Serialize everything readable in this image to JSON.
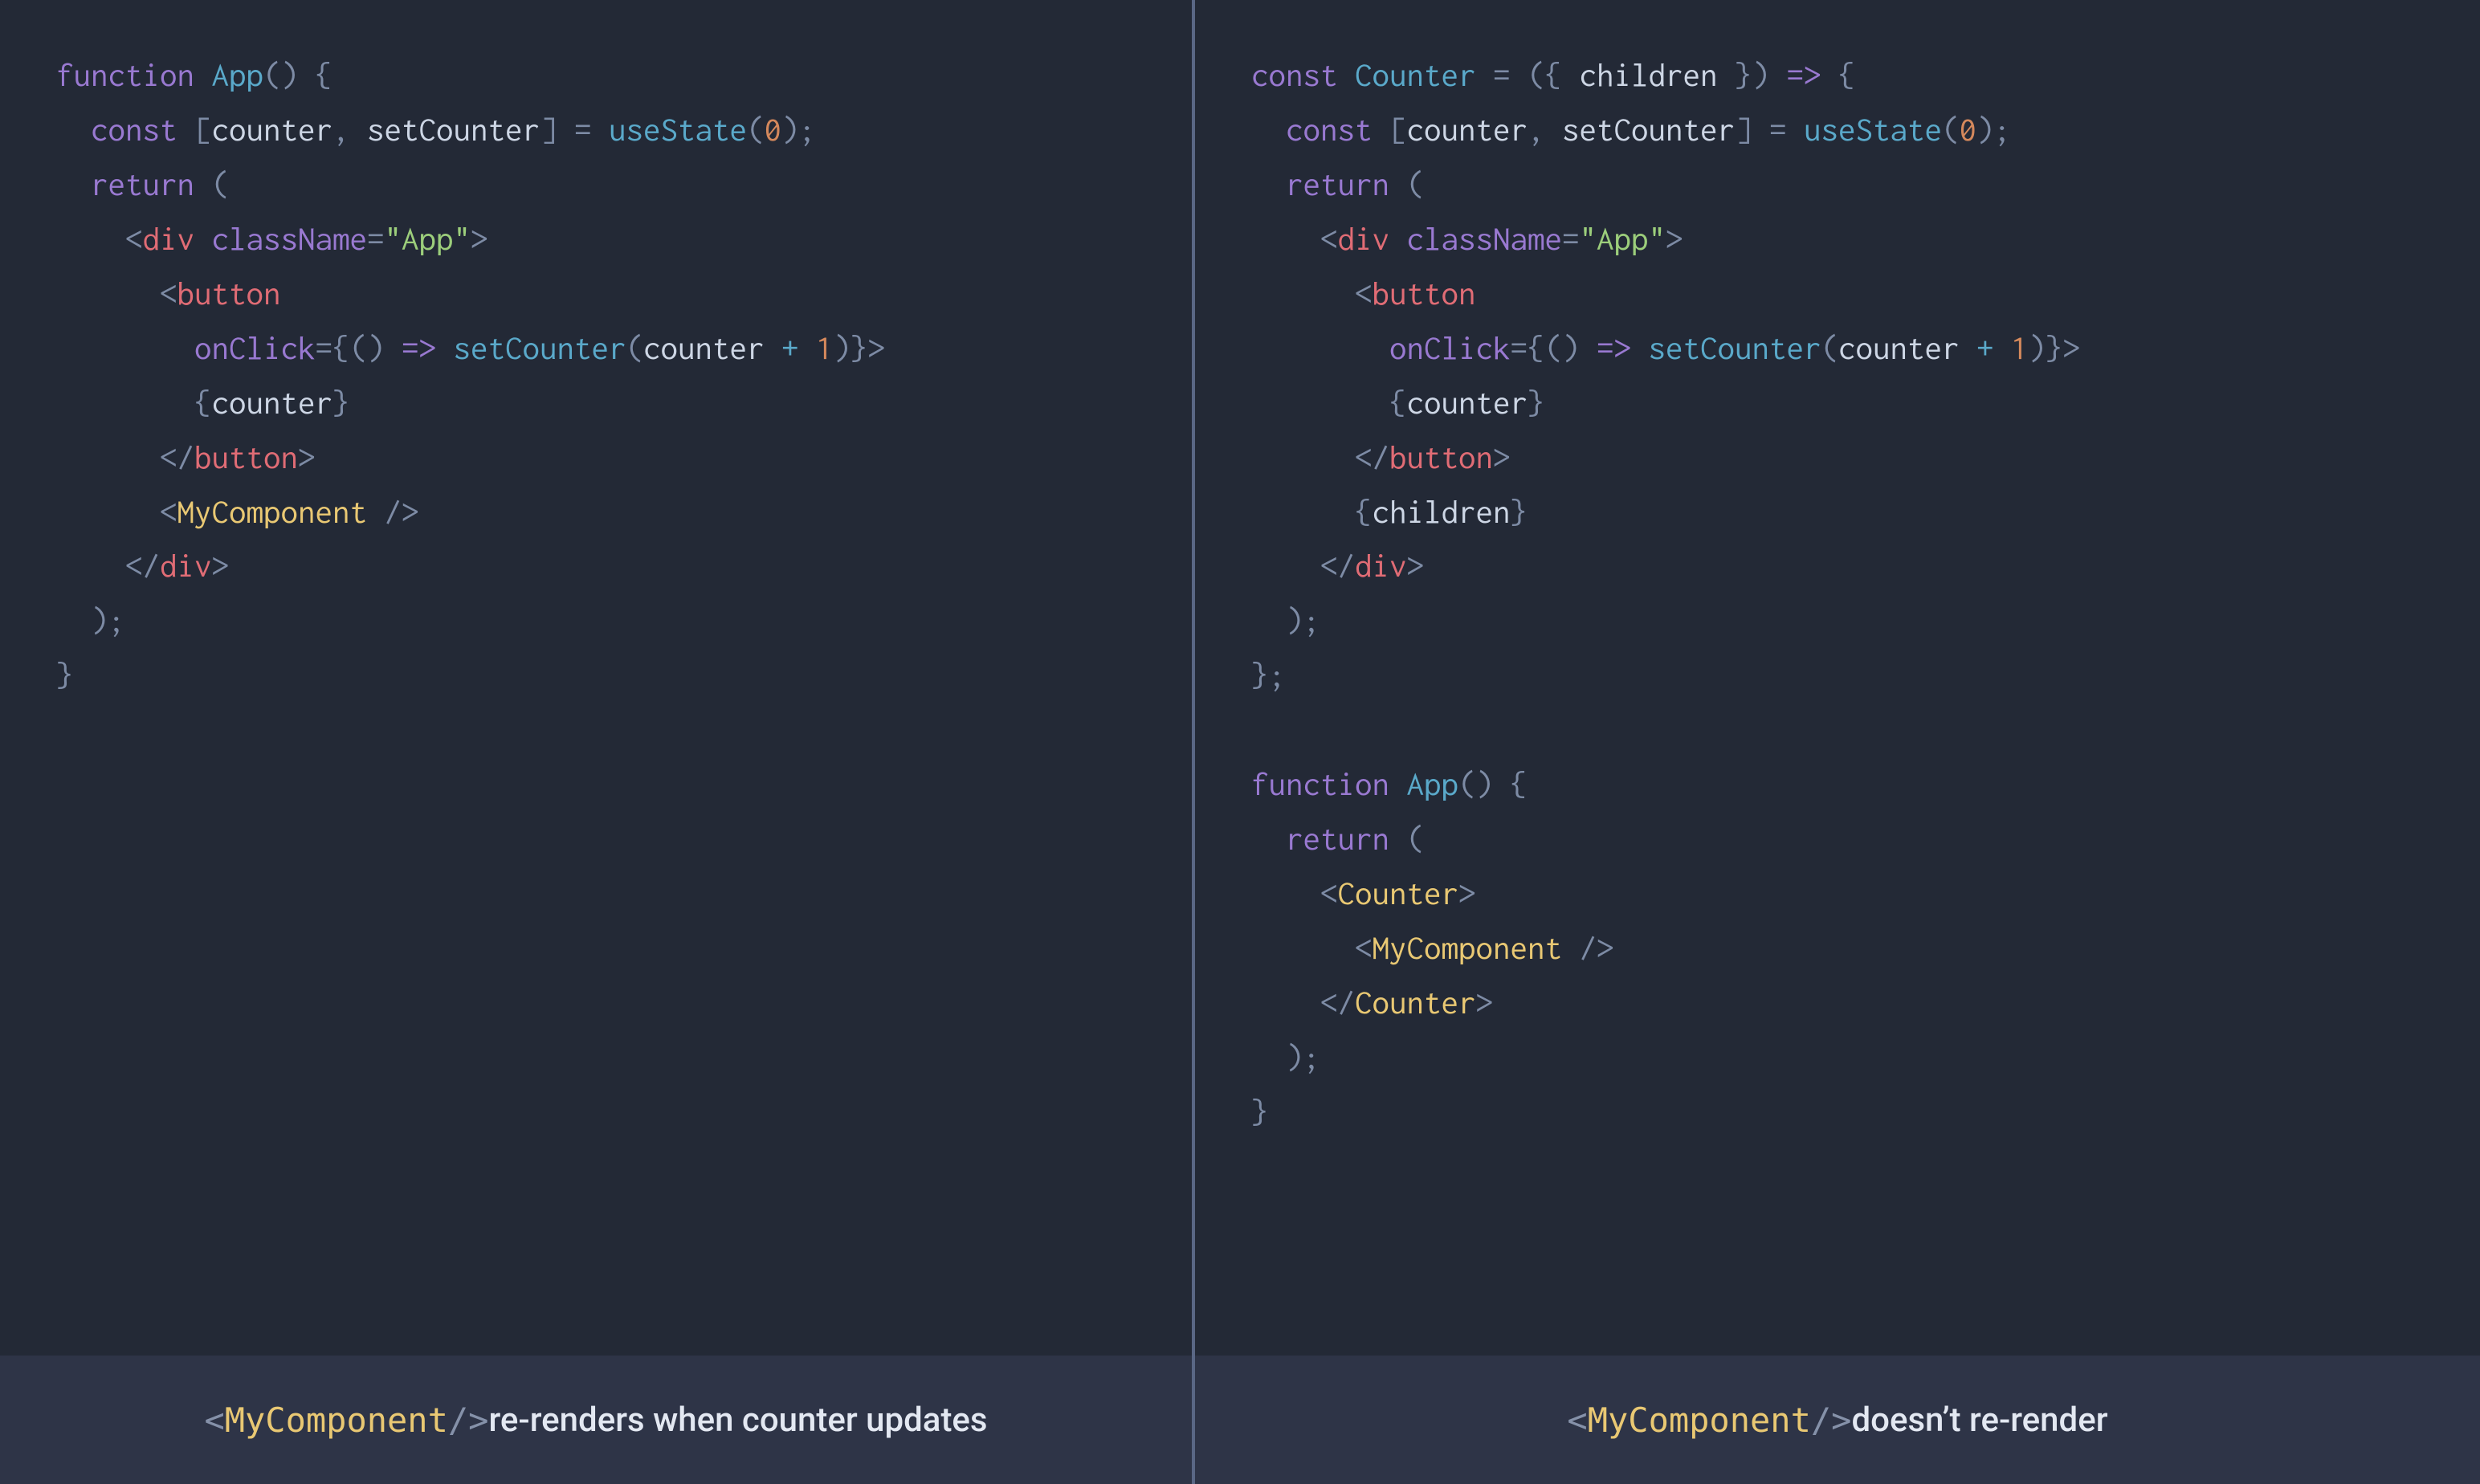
{
  "left": {
    "code": [
      {
        "indent": 0,
        "tokens": [
          {
            "c": "kw",
            "t": "function"
          },
          {
            "c": "txt",
            "t": " "
          },
          {
            "c": "fn",
            "t": "App"
          },
          {
            "c": "pn",
            "t": "() {"
          }
        ]
      },
      {
        "indent": 1,
        "tokens": [
          {
            "c": "kw",
            "t": "const"
          },
          {
            "c": "txt",
            "t": " "
          },
          {
            "c": "pn",
            "t": "["
          },
          {
            "c": "txt",
            "t": "counter"
          },
          {
            "c": "pn",
            "t": ", "
          },
          {
            "c": "txt",
            "t": "setCounter"
          },
          {
            "c": "pn",
            "t": "] = "
          },
          {
            "c": "fn",
            "t": "useState"
          },
          {
            "c": "pn",
            "t": "("
          },
          {
            "c": "num",
            "t": "0"
          },
          {
            "c": "pn",
            "t": ");"
          }
        ]
      },
      {
        "indent": 1,
        "tokens": [
          {
            "c": "kw",
            "t": "return"
          },
          {
            "c": "txt",
            "t": " "
          },
          {
            "c": "pn",
            "t": "("
          }
        ]
      },
      {
        "indent": 2,
        "tokens": [
          {
            "c": "ang",
            "t": "<"
          },
          {
            "c": "tag",
            "t": "div"
          },
          {
            "c": "txt",
            "t": " "
          },
          {
            "c": "attr",
            "t": "className"
          },
          {
            "c": "pn",
            "t": "="
          },
          {
            "c": "str",
            "t": "\"App\""
          },
          {
            "c": "ang",
            "t": ">"
          }
        ]
      },
      {
        "indent": 3,
        "tokens": [
          {
            "c": "ang",
            "t": "<"
          },
          {
            "c": "tag",
            "t": "button"
          }
        ]
      },
      {
        "indent": 4,
        "tokens": [
          {
            "c": "attr",
            "t": "onClick"
          },
          {
            "c": "pn",
            "t": "={() "
          },
          {
            "c": "kw",
            "t": "=>"
          },
          {
            "c": "txt",
            "t": " "
          },
          {
            "c": "fn",
            "t": "setCounter"
          },
          {
            "c": "pn",
            "t": "("
          },
          {
            "c": "txt",
            "t": "counter "
          },
          {
            "c": "op",
            "t": "+"
          },
          {
            "c": "txt",
            "t": " "
          },
          {
            "c": "num",
            "t": "1"
          },
          {
            "c": "pn",
            "t": ")}"
          },
          {
            "c": "ang",
            "t": ">"
          }
        ]
      },
      {
        "indent": 4,
        "tokens": [
          {
            "c": "pn",
            "t": "{"
          },
          {
            "c": "txt",
            "t": "counter"
          },
          {
            "c": "pn",
            "t": "}"
          }
        ]
      },
      {
        "indent": 3,
        "tokens": [
          {
            "c": "ang",
            "t": "</"
          },
          {
            "c": "tag",
            "t": "button"
          },
          {
            "c": "ang",
            "t": ">"
          }
        ]
      },
      {
        "indent": 3,
        "tokens": [
          {
            "c": "ang",
            "t": "<"
          },
          {
            "c": "cmp",
            "t": "MyComponent"
          },
          {
            "c": "txt",
            "t": " "
          },
          {
            "c": "ang",
            "t": "/>"
          }
        ]
      },
      {
        "indent": 2,
        "tokens": [
          {
            "c": "ang",
            "t": "</"
          },
          {
            "c": "tag",
            "t": "div"
          },
          {
            "c": "ang",
            "t": ">"
          }
        ]
      },
      {
        "indent": 1,
        "tokens": [
          {
            "c": "pn",
            "t": ");"
          }
        ]
      },
      {
        "indent": 0,
        "tokens": [
          {
            "c": "pn",
            "t": "}"
          }
        ]
      }
    ],
    "caption": [
      {
        "c": "cap-ang",
        "t": "<"
      },
      {
        "c": "cap-cmp",
        "t": "MyComponent "
      },
      {
        "c": "cap-ang",
        "t": "/>"
      },
      {
        "c": "cap-txt",
        "t": " re-renders when counter updates"
      }
    ]
  },
  "right": {
    "code": [
      {
        "indent": 0,
        "tokens": [
          {
            "c": "kw",
            "t": "const"
          },
          {
            "c": "txt",
            "t": " "
          },
          {
            "c": "fn",
            "t": "Counter"
          },
          {
            "c": "txt",
            "t": " "
          },
          {
            "c": "pn",
            "t": "= ({ "
          },
          {
            "c": "txt",
            "t": "children"
          },
          {
            "c": "pn",
            "t": " }) "
          },
          {
            "c": "kw",
            "t": "=>"
          },
          {
            "c": "pn",
            "t": " {"
          }
        ]
      },
      {
        "indent": 1,
        "tokens": [
          {
            "c": "kw",
            "t": "const"
          },
          {
            "c": "txt",
            "t": " "
          },
          {
            "c": "pn",
            "t": "["
          },
          {
            "c": "txt",
            "t": "counter"
          },
          {
            "c": "pn",
            "t": ", "
          },
          {
            "c": "txt",
            "t": "setCounter"
          },
          {
            "c": "pn",
            "t": "] = "
          },
          {
            "c": "fn",
            "t": "useState"
          },
          {
            "c": "pn",
            "t": "("
          },
          {
            "c": "num",
            "t": "0"
          },
          {
            "c": "pn",
            "t": ");"
          }
        ]
      },
      {
        "indent": 1,
        "tokens": [
          {
            "c": "kw",
            "t": "return"
          },
          {
            "c": "txt",
            "t": " "
          },
          {
            "c": "pn",
            "t": "("
          }
        ]
      },
      {
        "indent": 2,
        "tokens": [
          {
            "c": "ang",
            "t": "<"
          },
          {
            "c": "tag",
            "t": "div"
          },
          {
            "c": "txt",
            "t": " "
          },
          {
            "c": "attr",
            "t": "className"
          },
          {
            "c": "pn",
            "t": "="
          },
          {
            "c": "str",
            "t": "\"App\""
          },
          {
            "c": "ang",
            "t": ">"
          }
        ]
      },
      {
        "indent": 3,
        "tokens": [
          {
            "c": "ang",
            "t": "<"
          },
          {
            "c": "tag",
            "t": "button"
          }
        ]
      },
      {
        "indent": 4,
        "tokens": [
          {
            "c": "attr",
            "t": "onClick"
          },
          {
            "c": "pn",
            "t": "={() "
          },
          {
            "c": "kw",
            "t": "=>"
          },
          {
            "c": "txt",
            "t": " "
          },
          {
            "c": "fn",
            "t": "setCounter"
          },
          {
            "c": "pn",
            "t": "("
          },
          {
            "c": "txt",
            "t": "counter "
          },
          {
            "c": "op",
            "t": "+"
          },
          {
            "c": "txt",
            "t": " "
          },
          {
            "c": "num",
            "t": "1"
          },
          {
            "c": "pn",
            "t": ")}"
          },
          {
            "c": "ang",
            "t": ">"
          }
        ]
      },
      {
        "indent": 4,
        "tokens": [
          {
            "c": "pn",
            "t": "{"
          },
          {
            "c": "txt",
            "t": "counter"
          },
          {
            "c": "pn",
            "t": "}"
          }
        ]
      },
      {
        "indent": 3,
        "tokens": [
          {
            "c": "ang",
            "t": "</"
          },
          {
            "c": "tag",
            "t": "button"
          },
          {
            "c": "ang",
            "t": ">"
          }
        ]
      },
      {
        "indent": 3,
        "tokens": [
          {
            "c": "pn",
            "t": "{"
          },
          {
            "c": "txt",
            "t": "children"
          },
          {
            "c": "pn",
            "t": "}"
          }
        ]
      },
      {
        "indent": 2,
        "tokens": [
          {
            "c": "ang",
            "t": "</"
          },
          {
            "c": "tag",
            "t": "div"
          },
          {
            "c": "ang",
            "t": ">"
          }
        ]
      },
      {
        "indent": 1,
        "tokens": [
          {
            "c": "pn",
            "t": ");"
          }
        ]
      },
      {
        "indent": 0,
        "tokens": [
          {
            "c": "pn",
            "t": "};"
          }
        ]
      },
      {
        "indent": 0,
        "tokens": []
      },
      {
        "indent": 0,
        "tokens": [
          {
            "c": "kw",
            "t": "function"
          },
          {
            "c": "txt",
            "t": " "
          },
          {
            "c": "fn",
            "t": "App"
          },
          {
            "c": "pn",
            "t": "() {"
          }
        ]
      },
      {
        "indent": 1,
        "tokens": [
          {
            "c": "kw",
            "t": "return"
          },
          {
            "c": "txt",
            "t": " "
          },
          {
            "c": "pn",
            "t": "("
          }
        ]
      },
      {
        "indent": 2,
        "tokens": [
          {
            "c": "ang",
            "t": "<"
          },
          {
            "c": "cmp",
            "t": "Counter"
          },
          {
            "c": "ang",
            "t": ">"
          }
        ]
      },
      {
        "indent": 3,
        "tokens": [
          {
            "c": "ang",
            "t": "<"
          },
          {
            "c": "cmp",
            "t": "MyComponent"
          },
          {
            "c": "txt",
            "t": " "
          },
          {
            "c": "ang",
            "t": "/>"
          }
        ]
      },
      {
        "indent": 2,
        "tokens": [
          {
            "c": "ang",
            "t": "</"
          },
          {
            "c": "cmp",
            "t": "Counter"
          },
          {
            "c": "ang",
            "t": ">"
          }
        ]
      },
      {
        "indent": 1,
        "tokens": [
          {
            "c": "pn",
            "t": ");"
          }
        ]
      },
      {
        "indent": 0,
        "tokens": [
          {
            "c": "pn",
            "t": "}"
          }
        ]
      }
    ],
    "caption": [
      {
        "c": "cap-ang",
        "t": "<"
      },
      {
        "c": "cap-cmp",
        "t": "MyComponent "
      },
      {
        "c": "cap-ang",
        "t": "/>"
      },
      {
        "c": "cap-txt",
        "t": " doesn’t re-render"
      }
    ]
  },
  "indentUnit": "  "
}
